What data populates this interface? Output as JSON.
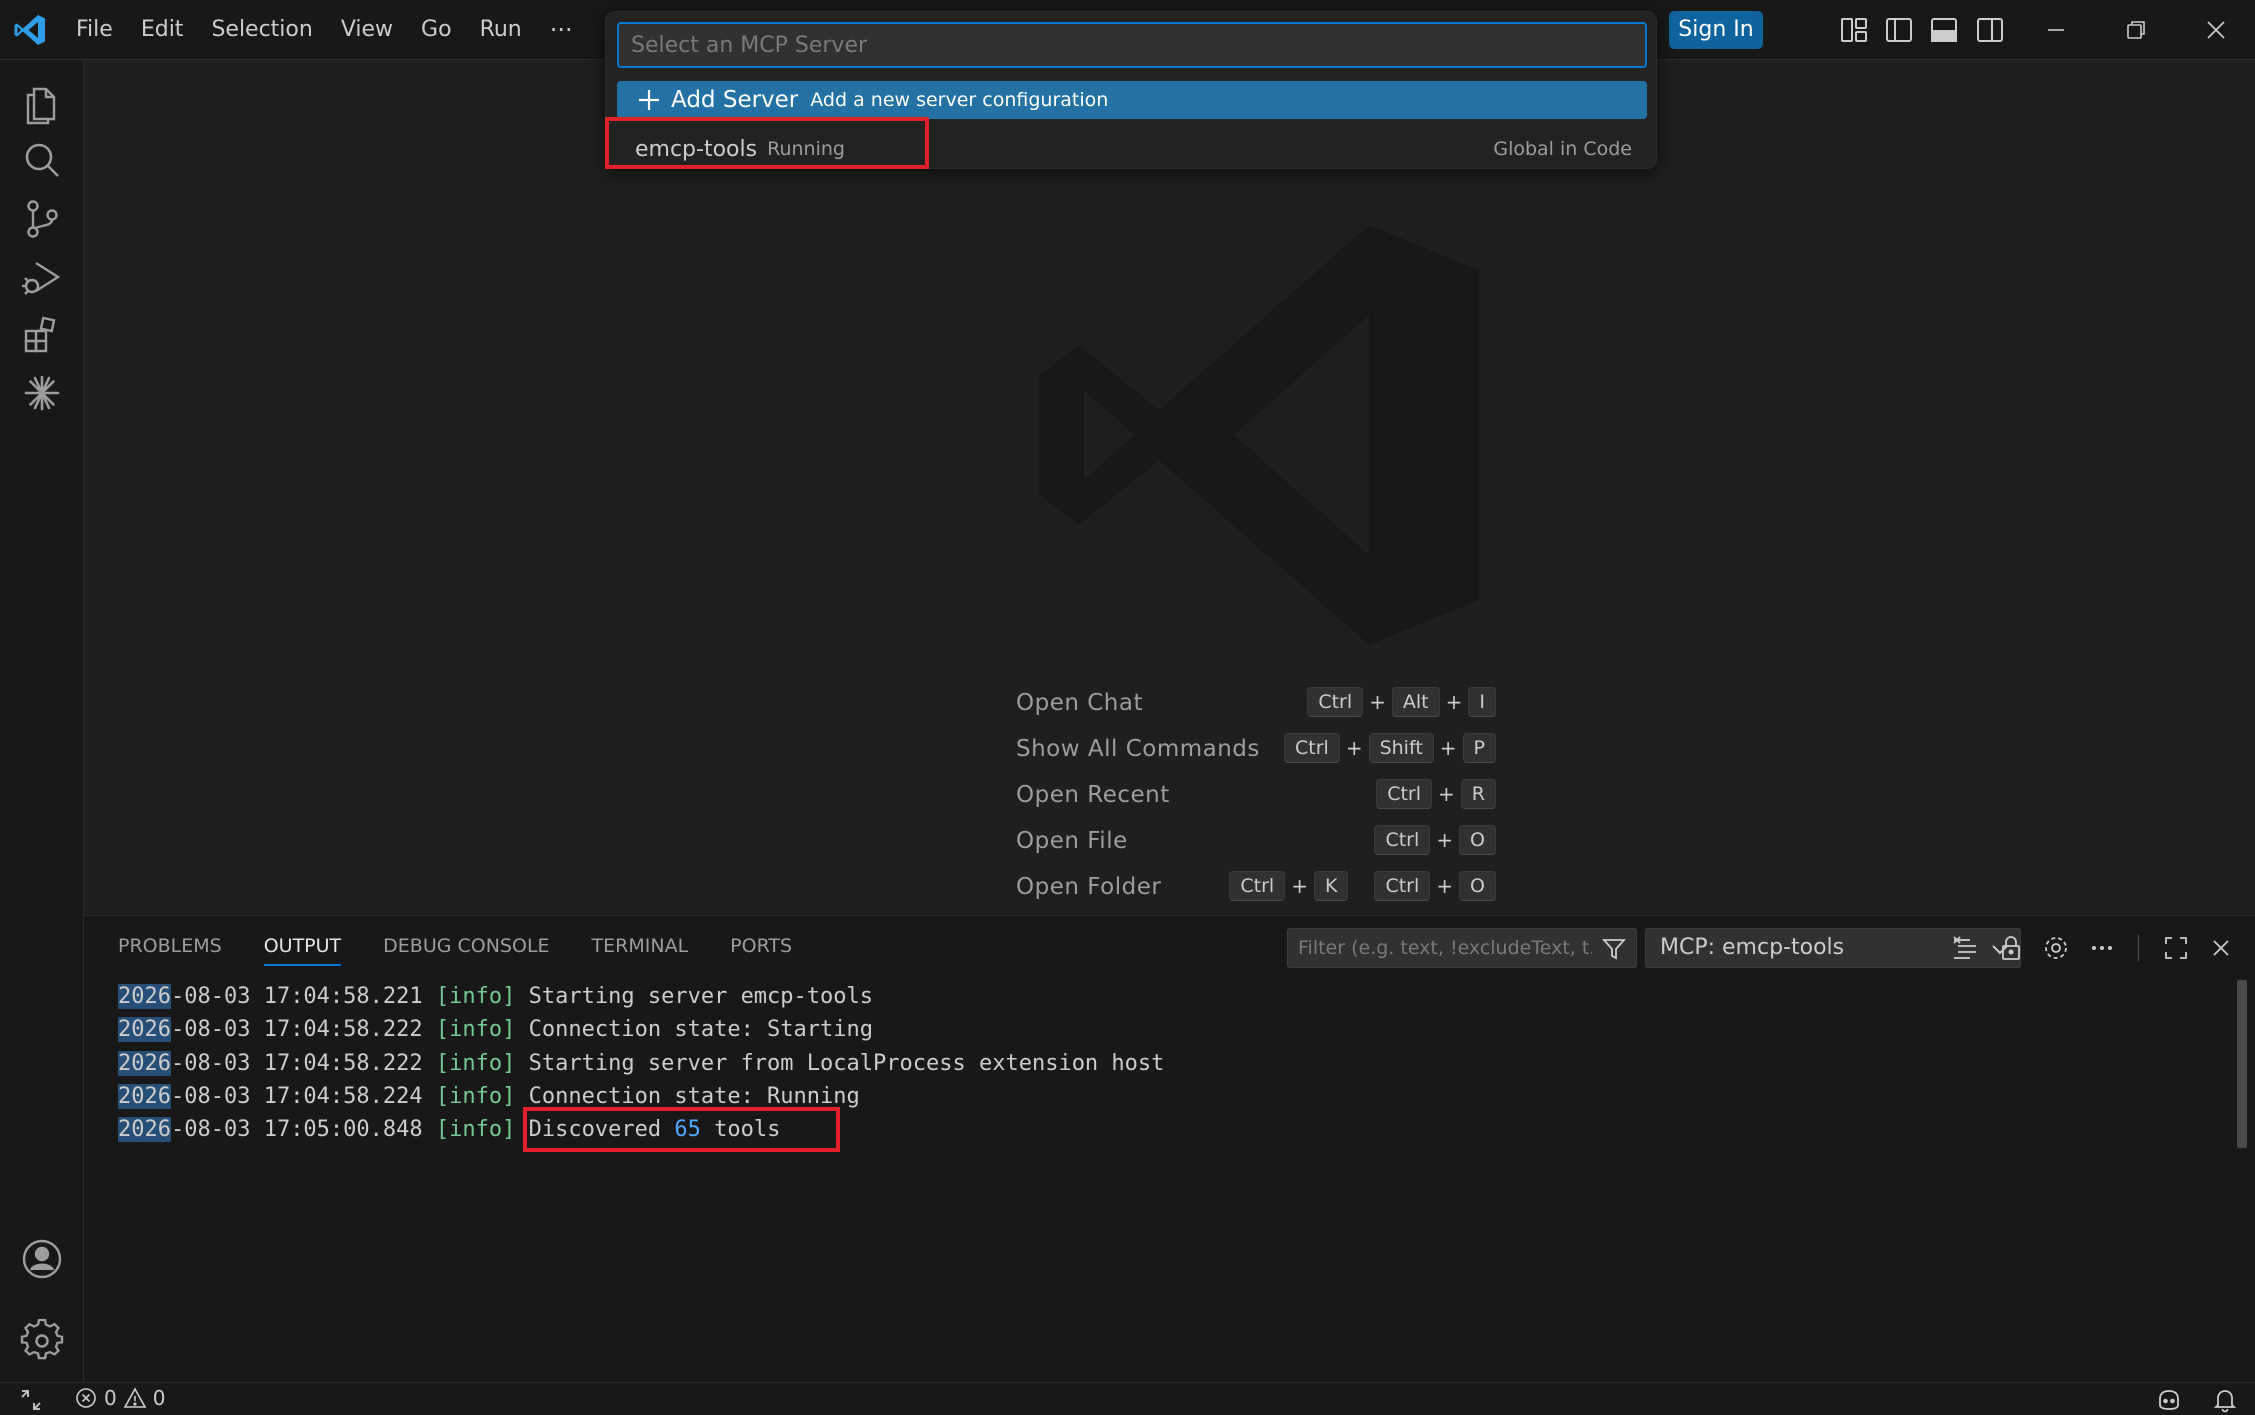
{
  "titlebar": {
    "menu": [
      "File",
      "Edit",
      "Selection",
      "View",
      "Go",
      "Run"
    ],
    "more_glyph": "···",
    "sign_in_label": "Sign In"
  },
  "quick_pick": {
    "placeholder": "Select an MCP Server",
    "items": [
      {
        "label": "Add Server",
        "description": "Add a new server configuration",
        "icon": "plus-icon",
        "selected": true
      },
      {
        "label": "emcp-tools",
        "description": "Running",
        "scope": "Global in Code",
        "selected": false
      }
    ]
  },
  "welcome": {
    "shortcuts": [
      {
        "label": "Open Chat",
        "keys": [
          [
            "Ctrl",
            "Alt",
            "I"
          ]
        ]
      },
      {
        "label": "Show All Commands",
        "keys": [
          [
            "Ctrl",
            "Shift",
            "P"
          ]
        ]
      },
      {
        "label": "Open Recent",
        "keys": [
          [
            "Ctrl",
            "R"
          ]
        ]
      },
      {
        "label": "Open File",
        "keys": [
          [
            "Ctrl",
            "O"
          ]
        ]
      },
      {
        "label": "Open Folder",
        "keys": [
          [
            "Ctrl",
            "K"
          ],
          [
            "Ctrl",
            "O"
          ]
        ]
      }
    ],
    "plus": "+"
  },
  "panel": {
    "tabs": [
      "PROBLEMS",
      "OUTPUT",
      "DEBUG CONSOLE",
      "TERMINAL",
      "PORTS"
    ],
    "active_tab": "OUTPUT",
    "filter_placeholder": "Filter (e.g. text, !excludeText, t...",
    "channel": "MCP: emcp-tools",
    "log": [
      {
        "date_hl": "2026",
        "date_rest": "-08-03 17:04:58.221",
        "level": "[info]",
        "message": "Starting server emcp-tools"
      },
      {
        "date_hl": "2026",
        "date_rest": "-08-03 17:04:58.222",
        "level": "[info]",
        "message": "Connection state: Starting"
      },
      {
        "date_hl": "2026",
        "date_rest": "-08-03 17:04:58.222",
        "level": "[info]",
        "message": "Starting server from LocalProcess extension host"
      },
      {
        "date_hl": "2026",
        "date_rest": "-08-03 17:04:58.224",
        "level": "[info]",
        "message": "Connection state: Running"
      },
      {
        "date_hl": "2026",
        "date_rest": "-08-03 17:05:00.848",
        "level": "[info]",
        "message_pre": "Discovered ",
        "message_num": "65",
        "message_post": " tools"
      }
    ]
  },
  "statusbar": {
    "errors": "0",
    "warnings": "0"
  },
  "colors": {
    "accent": "#0078d4",
    "highlight_box": "#e3202a",
    "sign_in_bg": "#0e639c"
  }
}
